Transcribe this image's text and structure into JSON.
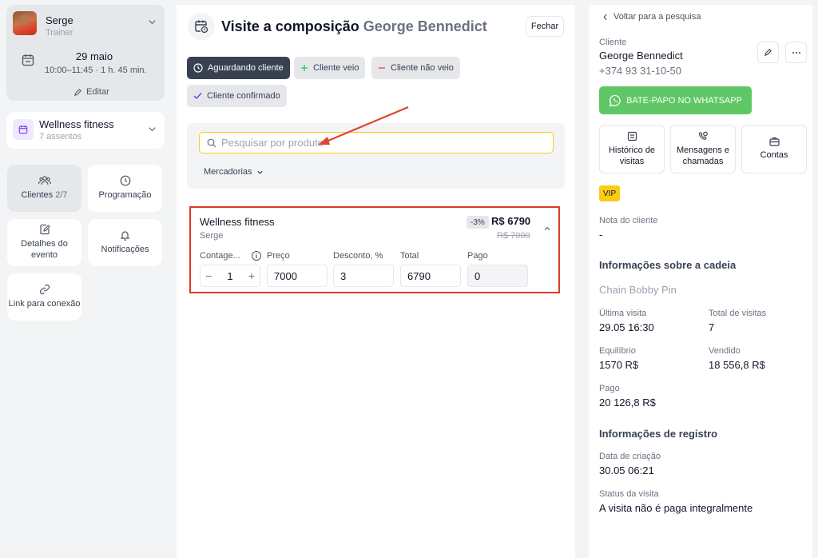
{
  "sidebar": {
    "trainer": {
      "name": "Serge",
      "role": "Trainer"
    },
    "date": "29 maio",
    "time": "10:00–11:45 · 1 h. 45 min.",
    "edit_label": "Editar",
    "venue": {
      "name": "Wellness fitness",
      "seats": "7 assentos"
    },
    "tiles": [
      {
        "label": "Clientes",
        "count": "2/7"
      },
      {
        "label": "Programação"
      },
      {
        "label": "Detalhes do evento"
      },
      {
        "label": "Notificações"
      },
      {
        "label": "Link para conexão"
      }
    ]
  },
  "main": {
    "title": "Visite a composição",
    "client_name": "George Bennedict",
    "close_label": "Fechar",
    "statuses": [
      {
        "label": "Aguardando cliente",
        "icon": "clock-icon",
        "active": true
      },
      {
        "label": "Cliente veio",
        "icon": "plus-icon",
        "color": "#22c55e"
      },
      {
        "label": "Cliente não veio",
        "icon": "minus-icon",
        "color": "#ef4444"
      },
      {
        "label": "Cliente confirmado",
        "icon": "check-icon",
        "color": "#4f46e5"
      }
    ],
    "search": {
      "placeholder": "Pesquisar por produto",
      "value": ""
    },
    "goods_label": "Mercadorias",
    "product": {
      "name": "Wellness fitness",
      "trainer": "Serge",
      "discount_badge": "-3%",
      "price": "R$ 6790",
      "old_price": "R$ 7000",
      "labels": {
        "count": "Contage...",
        "price": "Preço",
        "discount": "Desconto, %",
        "total": "Total",
        "paid": "Pago"
      },
      "values": {
        "count": "1",
        "price": "7000",
        "discount": "3",
        "total": "6790",
        "paid": "0"
      }
    },
    "highlight_color": "#dc3b26"
  },
  "client": {
    "back_label": "Voltar para a pesquisa",
    "label": "Cliente",
    "name": "George Bennedict",
    "phone": "+374 93 31-10-50",
    "whatsapp_label": "BATE-PAPO NO WHATSAPP",
    "actions": [
      "Histórico de visitas",
      "Mensagens e chamadas",
      "Contas"
    ],
    "badge": "VIP",
    "note_label": "Nota do cliente",
    "note_value": "-",
    "chain_title": "Informações sobre a cadeia",
    "chain_name": "Chain Bobby Pin",
    "stats": {
      "last_visit_label": "Última visita",
      "last_visit": "29.05 16:30",
      "total_visits_label": "Total de visitas",
      "total_visits": "7",
      "balance_label": "Equilíbrio",
      "balance": "1570 R$",
      "sold_label": "Vendido",
      "sold": "18 556,8 R$",
      "paid_label": "Pago",
      "paid": "20 126,8 R$"
    },
    "reg_title": "Informações de registro",
    "created_label": "Data de criação",
    "created": "30.05 06:21",
    "visit_status_label": "Status da visita",
    "visit_status": "A visita não é paga integralmente"
  }
}
